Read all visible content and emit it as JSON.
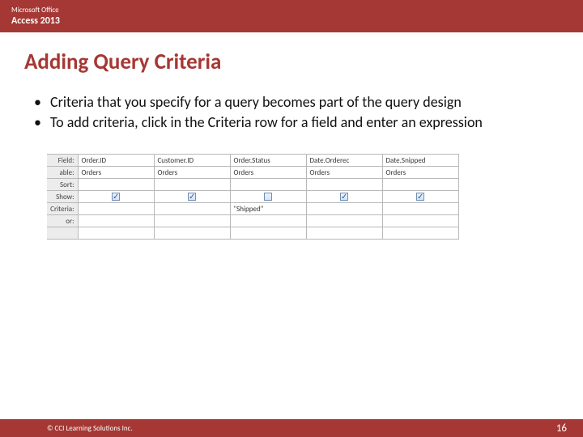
{
  "header": {
    "top": "Microsoft Office",
    "sub": "Access 2013"
  },
  "title": "Adding Query Criteria",
  "bullets": [
    "Criteria that you specify for a query becomes part of the query design",
    "To add criteria, click in the Criteria row for a field and enter an expression"
  ],
  "grid": {
    "row_labels": {
      "field": "Field:",
      "table": "able:",
      "sort": "Sort:",
      "show": "Show:",
      "criteria": "Criteria:",
      "or": "or:"
    },
    "columns": [
      {
        "field": "Order.ID",
        "table": "Orders",
        "show": true,
        "criteria": ""
      },
      {
        "field": "Customer.ID",
        "table": "Orders",
        "show": true,
        "criteria": ""
      },
      {
        "field": "Order.Status",
        "table": "Orders",
        "show": false,
        "criteria": "\"Shipped\""
      },
      {
        "field": "Date.Orderec",
        "table": "Orders",
        "show": true,
        "criteria": ""
      },
      {
        "field": "Date.Snipped",
        "table": "Orders",
        "show": true,
        "criteria": ""
      }
    ]
  },
  "footer": {
    "copyright": "© CCI Learning Solutions Inc.",
    "page": "16"
  }
}
